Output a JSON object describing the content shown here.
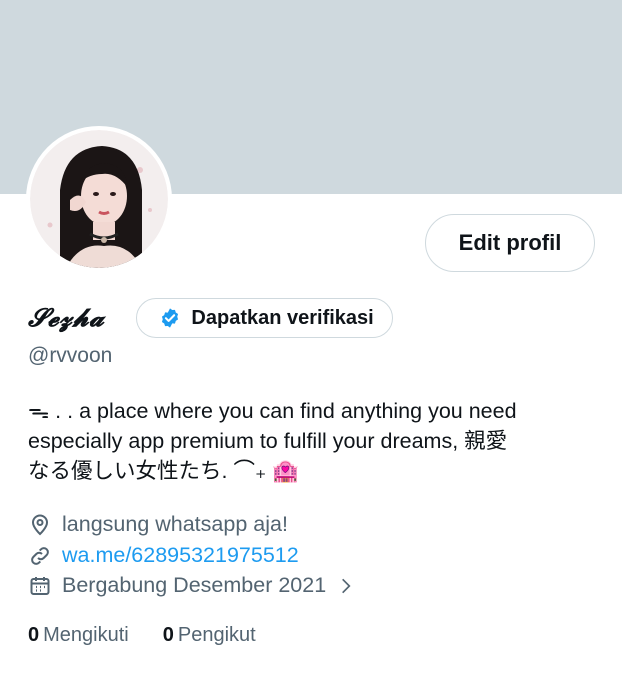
{
  "profile": {
    "display_name": "𝓢𝓮𝔃𝓱𝓪",
    "handle": "@rvvoon",
    "edit_label": "Edit profil",
    "verify_label": "Dapatkan verifikasi",
    "bio_line1": "ᯓ . . a place where you can find anything you need",
    "bio_line2": "especially app premium to fulfill your dreams, 親愛",
    "bio_line3": "なる優しい女性たち.  ⌒₊ 🏩",
    "location": "langsung whatsapp aja!",
    "website": "wa.me/62895321975512",
    "joined": "Bergabung Desember 2021",
    "following_count": "0",
    "following_label": "Mengikuti",
    "followers_count": "0",
    "followers_label": "Pengikut"
  },
  "icons": {
    "verify": "verified-badge-icon",
    "location": "location-pin-icon",
    "link": "link-icon",
    "calendar": "calendar-icon",
    "chevron": "chevron-right-icon"
  },
  "colors": {
    "banner": "#cfd9de",
    "accent": "#1d9bf0",
    "text": "#0f1419",
    "muted": "#536471"
  }
}
